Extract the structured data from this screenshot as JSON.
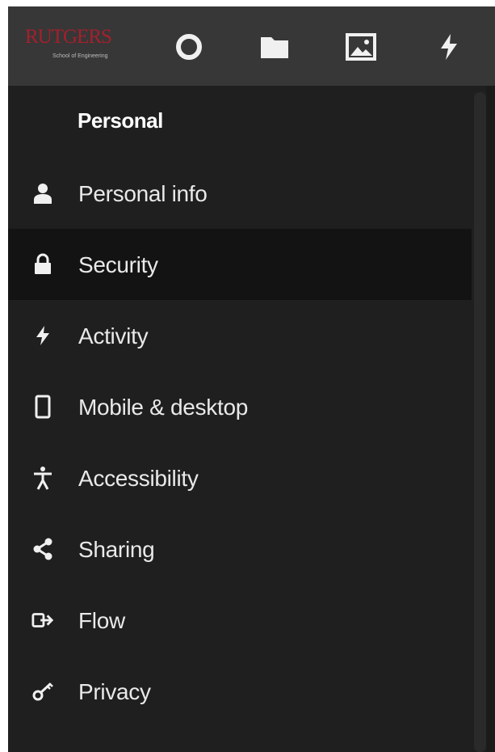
{
  "header": {
    "logo": {
      "wordmark": "RUTGERS",
      "subtitle": "School of Engineering"
    },
    "icons": [
      {
        "name": "circle-icon"
      },
      {
        "name": "folder-icon"
      },
      {
        "name": "image-icon"
      },
      {
        "name": "lightning-icon"
      }
    ]
  },
  "sidebar": {
    "section_title": "Personal",
    "selected": "Security",
    "items": [
      {
        "label": "Personal info",
        "icon": "person-icon"
      },
      {
        "label": "Security",
        "icon": "lock-icon"
      },
      {
        "label": "Activity",
        "icon": "lightning-icon"
      },
      {
        "label": "Mobile & desktop",
        "icon": "phone-icon"
      },
      {
        "label": "Accessibility",
        "icon": "accessibility-icon"
      },
      {
        "label": "Sharing",
        "icon": "share-icon"
      },
      {
        "label": "Flow",
        "icon": "flow-icon"
      },
      {
        "label": "Privacy",
        "icon": "key-icon"
      }
    ]
  },
  "colors": {
    "topbar": "#373737",
    "sidebar_bg": "#1f1f1f",
    "selected_bg": "#131313",
    "text": "#e9e9e9",
    "brand_red": "#a51f2d"
  }
}
